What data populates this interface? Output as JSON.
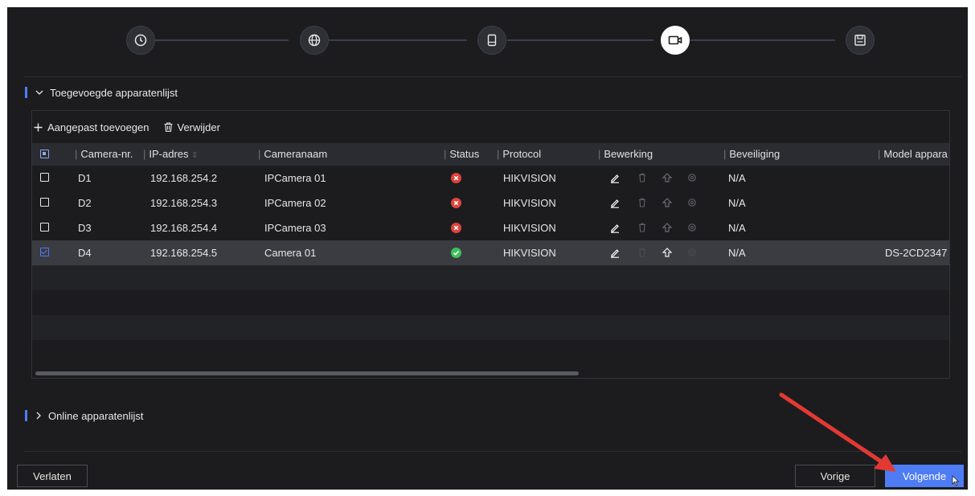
{
  "steps": [
    {
      "icon": "clock-icon",
      "active": false
    },
    {
      "icon": "globe-icon",
      "active": false
    },
    {
      "icon": "hdd-icon",
      "active": false
    },
    {
      "icon": "camera-icon",
      "active": true
    },
    {
      "icon": "save-icon",
      "active": false
    }
  ],
  "added_section": {
    "title": "Toegevoegde apparatenlijst",
    "expanded": true
  },
  "toolbar": {
    "add_label": "Aangepast toevoegen",
    "delete_label": "Verwijder"
  },
  "table": {
    "columns": {
      "camera_no": "Camera-nr.",
      "ip": "IP-adres",
      "name": "Cameranaam",
      "status": "Status",
      "protocol": "Protocol",
      "edit": "Bewerking",
      "security": "Beveiliging",
      "model": "Model appara"
    },
    "rows": [
      {
        "checked": false,
        "camera_no": "D1",
        "ip": "192.168.254.2",
        "name": "IPCamera 01",
        "status": "offline",
        "protocol": "HIKVISION",
        "security": "N/A",
        "model": ""
      },
      {
        "checked": false,
        "camera_no": "D2",
        "ip": "192.168.254.3",
        "name": "IPCamera 02",
        "status": "offline",
        "protocol": "HIKVISION",
        "security": "N/A",
        "model": ""
      },
      {
        "checked": false,
        "camera_no": "D3",
        "ip": "192.168.254.4",
        "name": "IPCamera 03",
        "status": "offline",
        "protocol": "HIKVISION",
        "security": "N/A",
        "model": ""
      },
      {
        "checked": true,
        "camera_no": "D4",
        "ip": "192.168.254.5",
        "name": "Camera 01",
        "status": "online",
        "protocol": "HIKVISION",
        "security": "N/A",
        "model": "DS-2CD2347"
      }
    ]
  },
  "online_section": {
    "title": "Online apparatenlijst",
    "expanded": false
  },
  "footer": {
    "exit_label": "Verlaten",
    "prev_label": "Vorige",
    "next_label": "Volgende"
  },
  "colors": {
    "accent": "#4d7cf5",
    "status_error": "#e0443b",
    "status_ok": "#3ec05a",
    "annotation_arrow": "#e23a33"
  }
}
